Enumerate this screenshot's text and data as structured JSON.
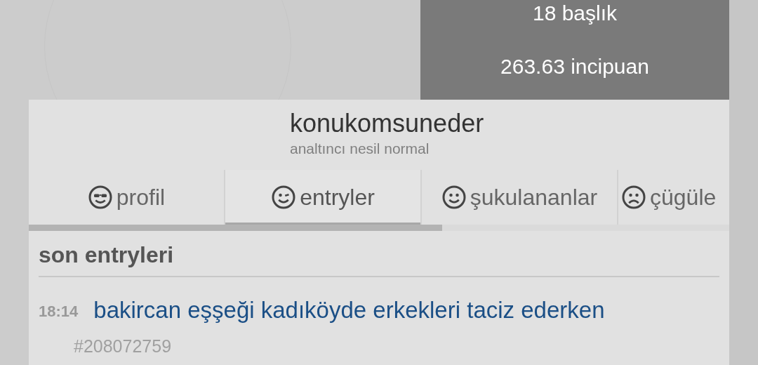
{
  "stats": {
    "topics": "18 başlık",
    "points": "263.63 incipuan"
  },
  "profile": {
    "nick": "konukomsuneder",
    "generation": "analtıncı nesil normal"
  },
  "tabs": [
    {
      "kind": "cool",
      "label": "profil",
      "selected": false
    },
    {
      "kind": "wink",
      "label": "entryler",
      "selected": true
    },
    {
      "kind": "smile",
      "label": "şukulananlar",
      "selected": false
    },
    {
      "kind": "frown",
      "label": "çügüle",
      "selected": false
    }
  ],
  "tab_indicator": {
    "level": 0.59
  },
  "section": {
    "title": "son entryleri"
  },
  "entries": [
    {
      "time": "18:14",
      "title": "bakircan eşşeği kadıköyde erkekleri taciz ederken",
      "number": "#208072759"
    }
  ]
}
